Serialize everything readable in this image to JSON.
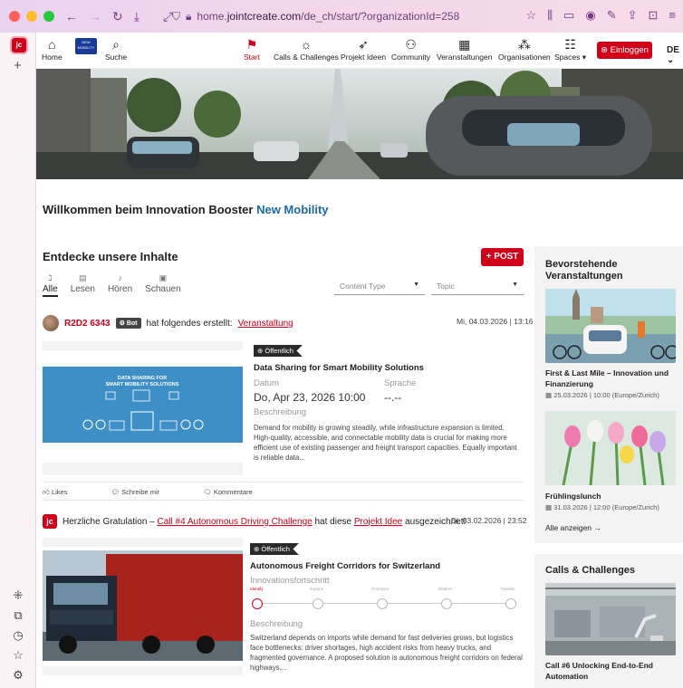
{
  "browser": {
    "url_prefix": "home.",
    "url_domain": "jointcreate.com",
    "url_path": "/de_ch/start/?organizationId=258"
  },
  "nav": {
    "home": "Home",
    "search": "Suche",
    "logo_text": "NEW MOBILITY",
    "items": [
      "Start",
      "Calls & Challenges",
      "Projekt Ideen",
      "Community",
      "Veranstaltungen",
      "Organisationen",
      "Spaces ▾"
    ],
    "login": "Einloggen",
    "lang": "DE"
  },
  "welcome": {
    "prefix": "Willkommen beim Innovation Booster ",
    "highlight": "New Mobility"
  },
  "discover": {
    "title": "Entdecke unsere Inhalte",
    "post_button": "POST",
    "tabs": [
      "Alle",
      "Lesen",
      "Hören",
      "Schauen"
    ],
    "content_type": "Content Type",
    "topic": "Topic"
  },
  "feed": [
    {
      "user": "R2D2 6343",
      "bot_label": "Bot",
      "action": "hat folgendes erstellt:",
      "link": "Veranstaltung",
      "date": "Mi, 04.03.2026 | 13:16",
      "image_text": "DATA SHARING FOR\nSMART MOBILITY SOLUTIONS",
      "badge": "Öffentlich",
      "title": "Data Sharing for Smart Mobility Solutions",
      "date_label": "Datum",
      "date_value": "Do, Apr 23, 2026 10:00",
      "lang_label": "Sprache",
      "lang_value": "--.--",
      "desc_label": "Beschreibung",
      "desc": "Demand for mobility is growing steadily, while infrastructure expansion is limited. High-quality, accessible, and connectable mobility data is crucial for making more efficient use of existing passenger and freight transport capacities. Equally important is reliable data...",
      "likes": "Likes",
      "write": "Schreibe mir",
      "comments": "Kommentare"
    },
    {
      "text_before": "Herzliche Gratulation – ",
      "call_link": "Call #4 Autonomous Driving Challenge",
      "text_mid": " hat diese ",
      "idea_link": "Projekt Idee",
      "text_after": " ausgezeichnet!",
      "date": "Di, 03.02.2026 | 23:52",
      "badge": "Öffentlich",
      "title": "Autonomous Freight Corridors for Switzerland",
      "progress_label": "Innovationsfortschritt",
      "steps": [
        "Identify",
        "Explore",
        "Prototype",
        "Realize",
        "Transfer"
      ],
      "progress_step": 1,
      "desc_label": "Beschreibung",
      "desc": "Switzerland depends on imports while demand for fast deliveries grows, but logistics face bottlenecks: driver shortages, high accident risks from heavy trucks, and fragmented governance. A proposed solution is autonomous freight corridors on federal highways,..."
    }
  ],
  "sidebar_right": {
    "events_title": "Bevorstehende Veranstaltungen",
    "events": [
      {
        "name": "First & Last Mile – Innovation und Finanzierung",
        "date": "25.03.2026",
        "time": "10:00 (Europe/Zurich)"
      },
      {
        "name": "Frühlingslunch",
        "date": "31.03.2026",
        "time": "12:00 (Europe/Zurich)"
      }
    ],
    "show_all": "Alle anzeigen",
    "calls_title": "Calls & Challenges",
    "call_name": "Call #6 Unlocking End-to-End Automation"
  },
  "colors": {
    "accent": "#d0001a",
    "highlight": "#1a6aa8"
  }
}
